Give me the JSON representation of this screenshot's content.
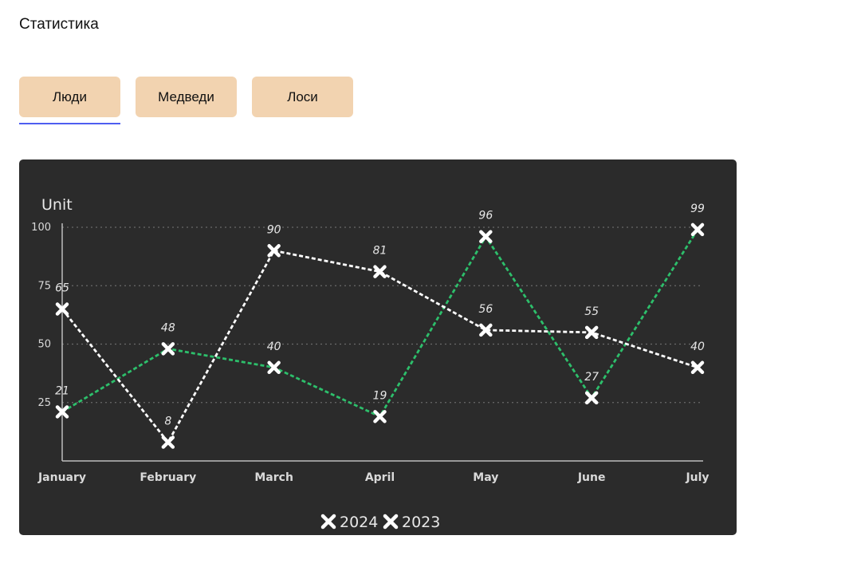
{
  "page": {
    "title": "Статистика"
  },
  "tabs": [
    {
      "label": "Люди",
      "active": true
    },
    {
      "label": "Медведи",
      "active": false
    },
    {
      "label": "Лоси",
      "active": false
    }
  ],
  "chart_data": {
    "type": "line",
    "ylabel": "Unit",
    "categories": [
      "January",
      "February",
      "March",
      "April",
      "May",
      "June",
      "July"
    ],
    "y_ticks": [
      25,
      50,
      75,
      100
    ],
    "ylim": [
      0,
      100
    ],
    "grid": true,
    "legend_position": "bottom",
    "series": [
      {
        "name": "2024",
        "color": "#2dbf6b",
        "values": [
          21,
          48,
          40,
          19,
          96,
          27,
          99
        ]
      },
      {
        "name": "2023",
        "color": "#ffffff",
        "values": [
          65,
          8,
          90,
          81,
          56,
          55,
          40
        ]
      }
    ]
  }
}
